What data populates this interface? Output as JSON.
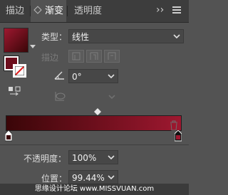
{
  "tabs": [
    {
      "label": "描边"
    },
    {
      "label": "渐变"
    },
    {
      "label": "透明度"
    }
  ],
  "header": {
    "overflow_label": "››"
  },
  "panel": {
    "type_label": "类型：",
    "type_value": "线性",
    "stroke_label": "描边",
    "angle_value": "0°",
    "opacity_label": "不透明度：",
    "opacity_value": "100%",
    "position_label": "位置：",
    "position_value": "99.44%"
  },
  "gradient": {
    "start_color": "#3a0608",
    "end_color": "#9e1830",
    "swatch_color": "#7a1020",
    "fill_color": "#6d0e1d"
  },
  "watermark": "思缘设计论坛 www.MISSVUAN.com"
}
